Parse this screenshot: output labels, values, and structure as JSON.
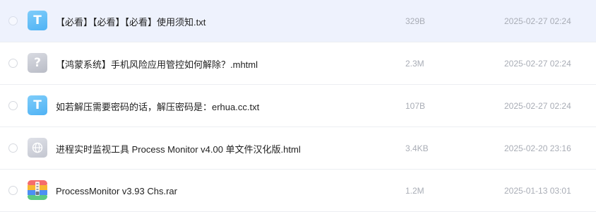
{
  "colors": {
    "selected_row_bg": "#eef2fd",
    "txt_icon": "#4fb2f4",
    "meta_text": "#a9adb6",
    "name_text": "#1f1f1f"
  },
  "files": [
    {
      "icon": "txt-file-icon",
      "glyph": "T",
      "name": "【必看】【必看】【必看】使用须知.txt",
      "size": "329B",
      "date": "2025-02-27 02:24",
      "selected": true
    },
    {
      "icon": "unknown-file-icon",
      "glyph": "?",
      "name": "【鸿蒙系统】手机风险应用管控如何解除？.mhtml",
      "size": "2.3M",
      "date": "2025-02-27 02:24",
      "selected": false
    },
    {
      "icon": "txt-file-icon",
      "glyph": "T",
      "name": "如若解压需要密码的话，解压密码是：erhua.cc.txt",
      "size": "107B",
      "date": "2025-02-27 02:24",
      "selected": false
    },
    {
      "icon": "html-file-globe-icon",
      "glyph": "",
      "name": "进程实时监视工具 Process Monitor v4.00 单文件汉化版.html",
      "size": "3.4KB",
      "date": "2025-02-20 23:16",
      "selected": false
    },
    {
      "icon": "rar-archive-icon",
      "glyph": "",
      "name": "ProcessMonitor v3.93 Chs.rar",
      "size": "1.2M",
      "date": "2025-01-13 03:01",
      "selected": false
    }
  ]
}
